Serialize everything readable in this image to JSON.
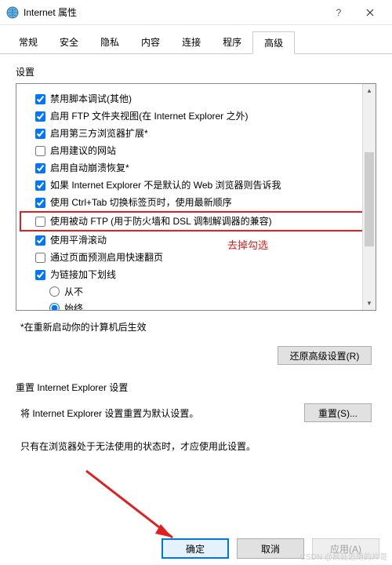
{
  "window": {
    "title": "Internet 属性"
  },
  "tabs": [
    "常规",
    "安全",
    "隐私",
    "内容",
    "连接",
    "程序",
    "高级"
  ],
  "active_tab_index": 6,
  "settings_label": "设置",
  "settings": [
    {
      "checked": true,
      "label": "禁用脚本调试(其他)"
    },
    {
      "checked": true,
      "label": "启用 FTP 文件夹视图(在 Internet Explorer 之外)"
    },
    {
      "checked": true,
      "label": "启用第三方浏览器扩展*"
    },
    {
      "checked": false,
      "label": "启用建议的网站"
    },
    {
      "checked": true,
      "label": "启用自动崩溃恢复*"
    },
    {
      "checked": true,
      "label": "如果 Internet Explorer 不是默认的 Web 浏览器则告诉我"
    },
    {
      "checked": true,
      "label": "使用 Ctrl+Tab 切换标签页时，使用最新顺序"
    },
    {
      "checked": false,
      "label": "使用被动 FTP (用于防火墙和 DSL 调制解调器的兼容)",
      "highlight": true
    },
    {
      "checked": true,
      "label": "使用平滑滚动"
    },
    {
      "checked": false,
      "label": "通过页面预测启用快速翻页"
    },
    {
      "checked": true,
      "label": "为链接加下划线"
    }
  ],
  "radio_options": [
    {
      "label": "从不",
      "checked": false
    },
    {
      "label": "始终",
      "checked": true
    }
  ],
  "annotation_text": "去掉勾选",
  "restart_note": "*在重新启动你的计算机后生效",
  "restore_btn": "还原高级设置(R)",
  "reset_section_label": "重置 Internet Explorer 设置",
  "reset_text": "将 Internet Explorer 设置重置为默认设置。",
  "reset_btn": "重置(S)...",
  "reset_note": "只有在浏览器处于无法使用的状态时，才应使用此设置。",
  "buttons": {
    "ok": "确定",
    "cancel": "取消",
    "apply": "应用(A)"
  },
  "watermark": "CSDN @疯狂追随的片哥"
}
